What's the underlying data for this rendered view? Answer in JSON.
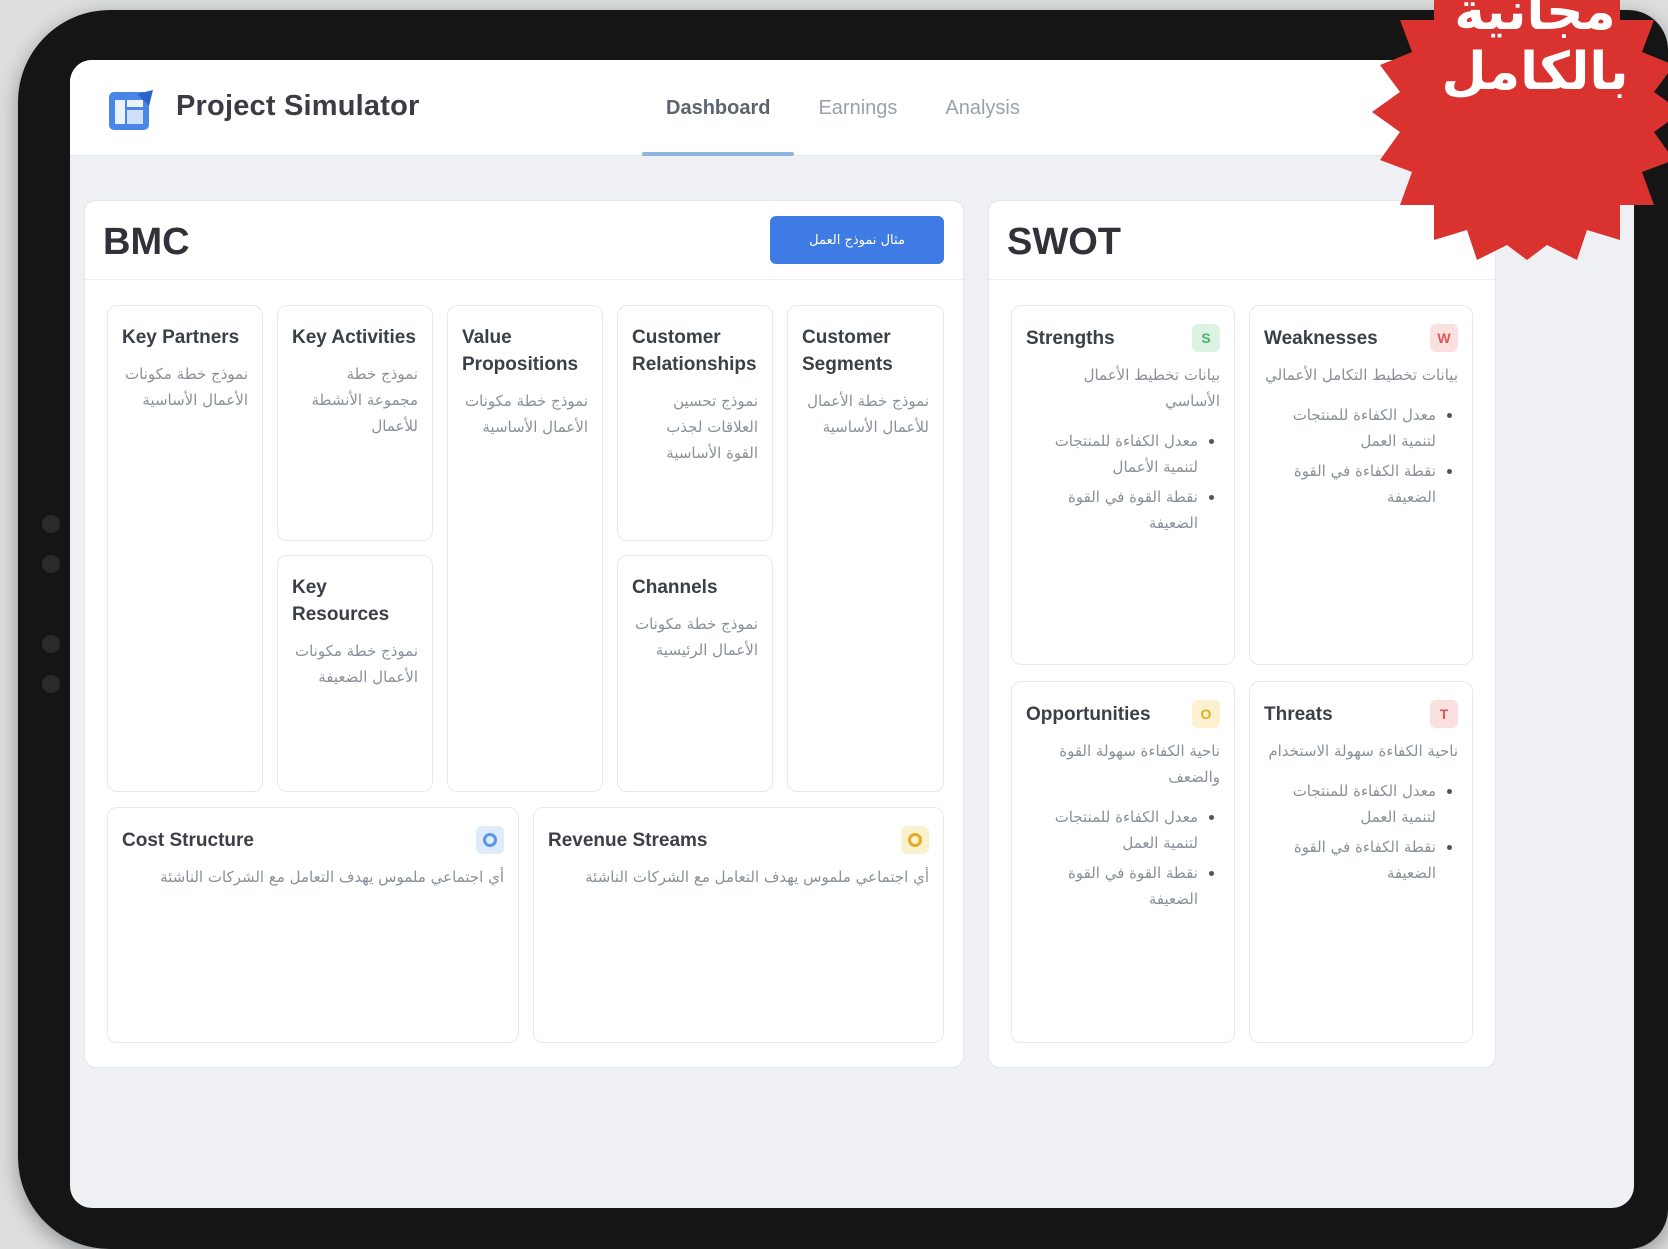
{
  "app": {
    "title": "Project Simulator",
    "accent_color": "#3f7be4",
    "logo_icon": "spreadsheet-logo-icon"
  },
  "nav": {
    "tabs": [
      {
        "label": "Dashboard",
        "active": true
      },
      {
        "label": "Earnings",
        "active": false
      },
      {
        "label": "Analysis",
        "active": false
      }
    ]
  },
  "bmc": {
    "title": "BMC",
    "action_button": "مثال نموذج العمل",
    "cards": {
      "key_partners": {
        "title": "Key Partners",
        "body": "نموذج خطة مكونات الأعمال الأساسية"
      },
      "key_activities": {
        "title": "Key Activities",
        "body": "نموذج خطة مجموعة الأنشطة للأعمال"
      },
      "key_resources": {
        "title": "Key Resources",
        "body": "نموذج خطة مكونات الأعمال الضعيفة"
      },
      "value_propositions": {
        "title": "Value Propositions",
        "body": "نموذج خطة مكونات الأعمال الأساسية"
      },
      "customer_relationships": {
        "title": "Customer Relationships",
        "body": "نموذج تحسين العلاقات لجذب القوة الأساسية"
      },
      "channels": {
        "title": "Channels",
        "body": "نموذج خطة مكونات الأعمال الرئيسية"
      },
      "customer_segments": {
        "title": "Customer Segments",
        "body": "نموذج خطة الأعمال للأعمال الأساسية"
      },
      "cost_structure": {
        "title": "Cost Structure",
        "body": "أي اجتماعي ملموس يهدف التعامل مع الشركات الناشئة",
        "icon": "gear-icon"
      },
      "revenue_streams": {
        "title": "Revenue Streams",
        "body": "أي اجتماعي ملموس يهدف التعامل مع الشركات الناشئة",
        "icon": "coin-icon"
      }
    }
  },
  "swot": {
    "title": "SWOT",
    "cards": {
      "strengths": {
        "title": "Strengths",
        "badge": "S",
        "body": "بيانات تخطيط الأعمال الأساسي",
        "bullets": [
          "معدل الكفاءة للمنتجات لتنمية الأعمال",
          "نقطة القوة في القوة الضعيفة"
        ]
      },
      "weaknesses": {
        "title": "Weaknesses",
        "badge": "W",
        "body": "بيانات تخطيط التكامل الأعمالي",
        "bullets": [
          "معدل الكفاءة للمنتجات لتنمية العمل",
          "نقطة الكفاءة في القوة الضعيفة"
        ]
      },
      "opportunities": {
        "title": "Opportunities",
        "badge": "O",
        "body": "ناحية الكفاءة سهولة القوة والضعف",
        "bullets": [
          "معدل الكفاءة للمنتجات لتنمية العمل",
          "نقطة القوة في القوة الضعيفة"
        ]
      },
      "threats": {
        "title": "Threats",
        "badge": "T",
        "body": "ناحية الكفاءة سهولة الاستخدام",
        "bullets": [
          "معدل الكفاءة للمنتجات لتنمية العمل",
          "نقطة الكفاءة في القوة الضعيفة"
        ]
      }
    }
  },
  "promo": {
    "line1": "مجانية",
    "line2": "بالكامل",
    "color": "#d9322f"
  }
}
